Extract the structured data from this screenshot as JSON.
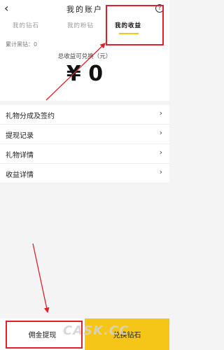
{
  "header": {
    "back_icon": "‹",
    "title": "我的账户",
    "help_icon": "?"
  },
  "tabs": [
    {
      "label": "我的钻石"
    },
    {
      "label": "我的粉钻"
    },
    {
      "label": "我的收益"
    }
  ],
  "summary": {
    "account_label": "累计黑钻：0",
    "total_label": "总收益可兑换（元）",
    "amount": "¥ 0"
  },
  "menu": [
    {
      "label": "礼物分成及签约",
      "chevron": "›"
    },
    {
      "label": "提现记录",
      "chevron": "›"
    },
    {
      "label": "礼物详情",
      "chevron": "›"
    },
    {
      "label": "收益详情",
      "chevron": "›"
    }
  ],
  "footer": {
    "withdraw_label": "佣金提现",
    "exchange_label": "兑换钻石"
  },
  "watermark": "CASK.CC",
  "colors": {
    "accent": "#f5c518",
    "annotation": "#e0202a"
  }
}
